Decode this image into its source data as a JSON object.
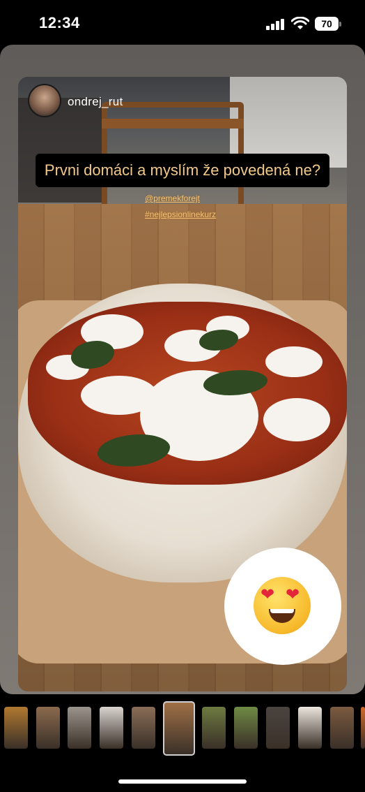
{
  "status_bar": {
    "time": "12:34",
    "battery": "70"
  },
  "story": {
    "username": "ondrej_rut",
    "caption": "Prvni domáci a myslím že povedená ne?",
    "mention": "@premekforejt",
    "hashtag": "#nejlepsionlinekurz",
    "reaction_emoji": "smiling-face-with-heart-eyes"
  },
  "thumbnails": [
    {
      "name": "thumb-1",
      "color": "#b0792f"
    },
    {
      "name": "thumb-2",
      "color": "#8b6a4d"
    },
    {
      "name": "thumb-3",
      "color": "#9c958d"
    },
    {
      "name": "thumb-4",
      "color": "#d9d4cf"
    },
    {
      "name": "thumb-5",
      "color": "#8a6d57"
    },
    {
      "name": "thumb-6-active",
      "color": "#a07046"
    },
    {
      "name": "thumb-7",
      "color": "#6d7a40"
    },
    {
      "name": "thumb-8",
      "color": "#6f8a44"
    },
    {
      "name": "thumb-9",
      "color": "#4a4440"
    },
    {
      "name": "thumb-10",
      "color": "#ece6df"
    },
    {
      "name": "thumb-11",
      "color": "#7b5a40"
    },
    {
      "name": "thumb-12",
      "color": "#d06b2a"
    }
  ],
  "colors": {
    "caption_text": "#f2c98a",
    "mention_text": "#f0c27a",
    "sheet_bg": "#6f6b67"
  }
}
